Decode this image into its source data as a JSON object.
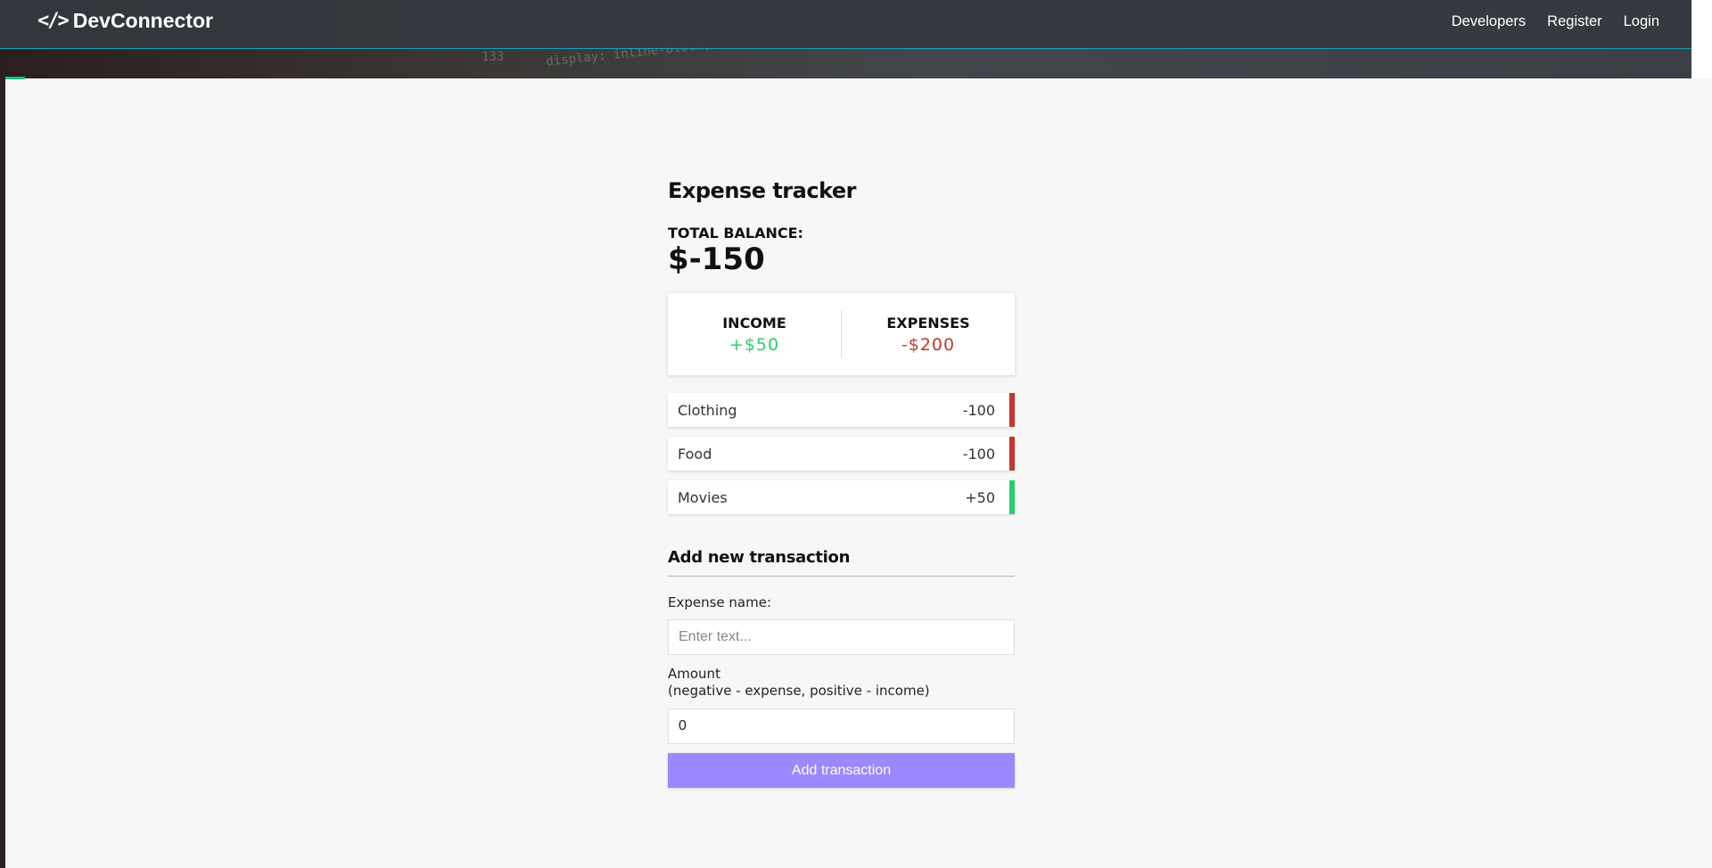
{
  "navbar": {
    "brand_icon": "</>",
    "brand": "DevConnector",
    "links": [
      "Developers",
      "Register",
      "Login"
    ]
  },
  "background": {
    "code_line_number": "133",
    "code_text": "display: inline-block;"
  },
  "tracker": {
    "title": "Expense tracker",
    "balance_label": "TOTAL BALANCE:",
    "balance_value": "$-150",
    "income_label": "INCOME",
    "income_value": "+$50",
    "expenses_label": "EXPENSES",
    "expenses_value": "-$200",
    "transactions": [
      {
        "name": "Clothing",
        "amount": "-100",
        "type": "minus"
      },
      {
        "name": "Food",
        "amount": "-100",
        "type": "minus"
      },
      {
        "name": "Movies",
        "amount": "+50",
        "type": "plus"
      }
    ]
  },
  "form": {
    "title": "Add new transaction",
    "name_label": "Expense name:",
    "name_placeholder": "Enter text...",
    "amount_label_line1": "Amount",
    "amount_label_line2": "(negative - expense, positive - income)",
    "amount_value": "0",
    "submit_label": "Add transaction"
  },
  "colors": {
    "navbar": "#343a40",
    "accent": "#17a2b8",
    "plus": "#2ecc71",
    "minus": "#c0392b",
    "button": "#9c88ff"
  }
}
